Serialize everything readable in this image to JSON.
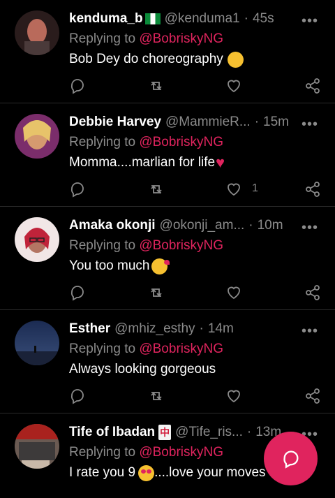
{
  "colors": {
    "accent": "#e0245e",
    "muted": "#8b8b8b",
    "background": "#000000"
  },
  "tweets": [
    {
      "name": "kenduma_b",
      "badge": "flag-nigeria",
      "handle": "@kenduma1",
      "time": "45s",
      "reply_prefix": "Replying to ",
      "mention": "@BobriskyNG",
      "text": "Bob Dey do choreography",
      "emoji": "tears-of-joy-emoji",
      "likes": ""
    },
    {
      "name": "Debbie Harvey",
      "badge": "",
      "handle": "@MammieR...",
      "time": "15m",
      "reply_prefix": "Replying to ",
      "mention": "@BobriskyNG",
      "text": "Momma....marlian for life",
      "emoji": "red-heart-emoji",
      "likes": "1"
    },
    {
      "name": "Amaka okonji",
      "badge": "",
      "handle": "@okonji_am...",
      "time": "10m",
      "reply_prefix": "Replying to ",
      "mention": "@BobriskyNG",
      "text": "You too much",
      "emoji": "kiss-emoji",
      "likes": ""
    },
    {
      "name": "Esther",
      "badge": "",
      "handle": "@mhiz_esthy",
      "time": "14m",
      "reply_prefix": "Replying to ",
      "mention": "@BobriskyNG",
      "text": "Always looking gorgeous",
      "emoji": "",
      "likes": ""
    },
    {
      "name": "Tife of Ibadan",
      "badge": "mahjong-red-dragon",
      "badge_text": "中",
      "handle": "@Tife_ris...",
      "time": "13m",
      "reply_prefix": "Replying to ",
      "mention": "@BobriskyNG",
      "text_a": "I rate you 9 ",
      "text_b": "....love your moves",
      "emoji": "heart-eyes-emoji",
      "likes": ""
    }
  ],
  "icons": {
    "more": "more-dots-icon",
    "reply": "reply-icon",
    "retweet": "retweet-icon",
    "like": "heart-icon",
    "share": "share-icon",
    "compose": "compose-reply-icon"
  },
  "fab": {
    "label": "Reply"
  }
}
